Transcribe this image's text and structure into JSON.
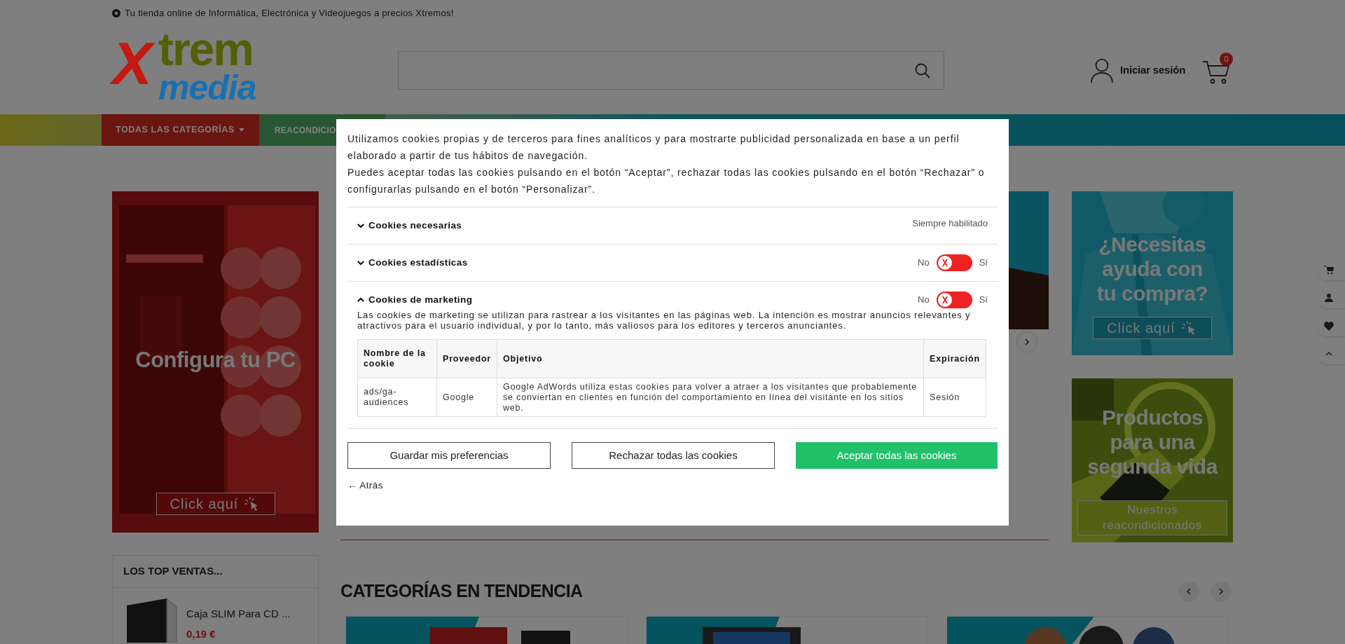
{
  "top_bar": {
    "text": "Tu tienda online de Informática, Electrónica y Videojuegos a precios Xtremos!"
  },
  "logo": {
    "parts": [
      "X",
      "trem",
      "media"
    ]
  },
  "account": {
    "label": "Iniciar sesión"
  },
  "cart": {
    "count": "0"
  },
  "nav": [
    {
      "label": "TODAS LAS CATEGORÍAS",
      "kind": "menu"
    },
    {
      "label": "REACONDICIO",
      "kind": "link"
    }
  ],
  "left_banner": {
    "title": "Configura tu PC",
    "button": "Click aquí"
  },
  "right_banners": [
    {
      "title": "¿Necesitas ayuda con tu compra?",
      "button": "Click aquí",
      "kind": "help"
    },
    {
      "title": "Productos para una segunda vida",
      "button": "Nuestros reacondicionados",
      "kind": "refurbished"
    }
  ],
  "top_sales": {
    "title": "LOS TOP VENTAS...",
    "products": [
      {
        "name": "Caja SLIM Para CD ...",
        "price": "0,19 €"
      }
    ]
  },
  "trending": {
    "title": "CATEGORÍAS EN TENDENCIA"
  },
  "cookie_dialog": {
    "intro": [
      "Utilizamos cookies propias y de terceros para fines analíticos y para mostrarte publicidad personalizada en base a un perfil elaborado a partir de tus hábitos de navegación.",
      "Puedes aceptar todas las cookies pulsando en el botón “Aceptar”, rechazar todas las cookies pulsando en el botón “Rechazar” o configurarlas pulsando en el botón “Personalizar”."
    ],
    "sections": [
      {
        "title": "Cookies necesarias",
        "kind": "always",
        "expanded": false,
        "status": "Siempre habilitado"
      },
      {
        "title": "Cookies estadísticas",
        "kind": "toggle",
        "expanded": false,
        "off_label": "No",
        "on_label": "Sí",
        "on": false
      },
      {
        "title": "Cookies de marketing",
        "kind": "toggle",
        "expanded": true,
        "off_label": "No",
        "on_label": "Sí",
        "on": false,
        "description": "Las cookies de marketing se utilizan para rastrear a los visitantes en las páginas web. La intención es mostrar anuncios relevantes y atractivos para el usuario individual, y por lo tanto, más valiosos para los editores y terceros anunciantes.",
        "table": {
          "columns": [
            "Nombre de la cookie",
            "Proveedor",
            "Objetivo",
            "Expiración"
          ],
          "rows": [
            [
              "ads/ga-audiences",
              "Google",
              "Google AdWords utiliza estas cookies para volver a atraer a los visitantes que probablemente se conviertan en clientes en función del comportamiento en línea del visitante en los sitios web.",
              "Sesión"
            ]
          ]
        }
      }
    ],
    "buttons": [
      {
        "label": "Guardar mis preferencias",
        "kind": "outline"
      },
      {
        "label": "Rechazar todas las cookies",
        "kind": "outline"
      },
      {
        "label": "Aceptar todas las cookies",
        "kind": "primary"
      }
    ],
    "back_link": "← Atrás"
  }
}
